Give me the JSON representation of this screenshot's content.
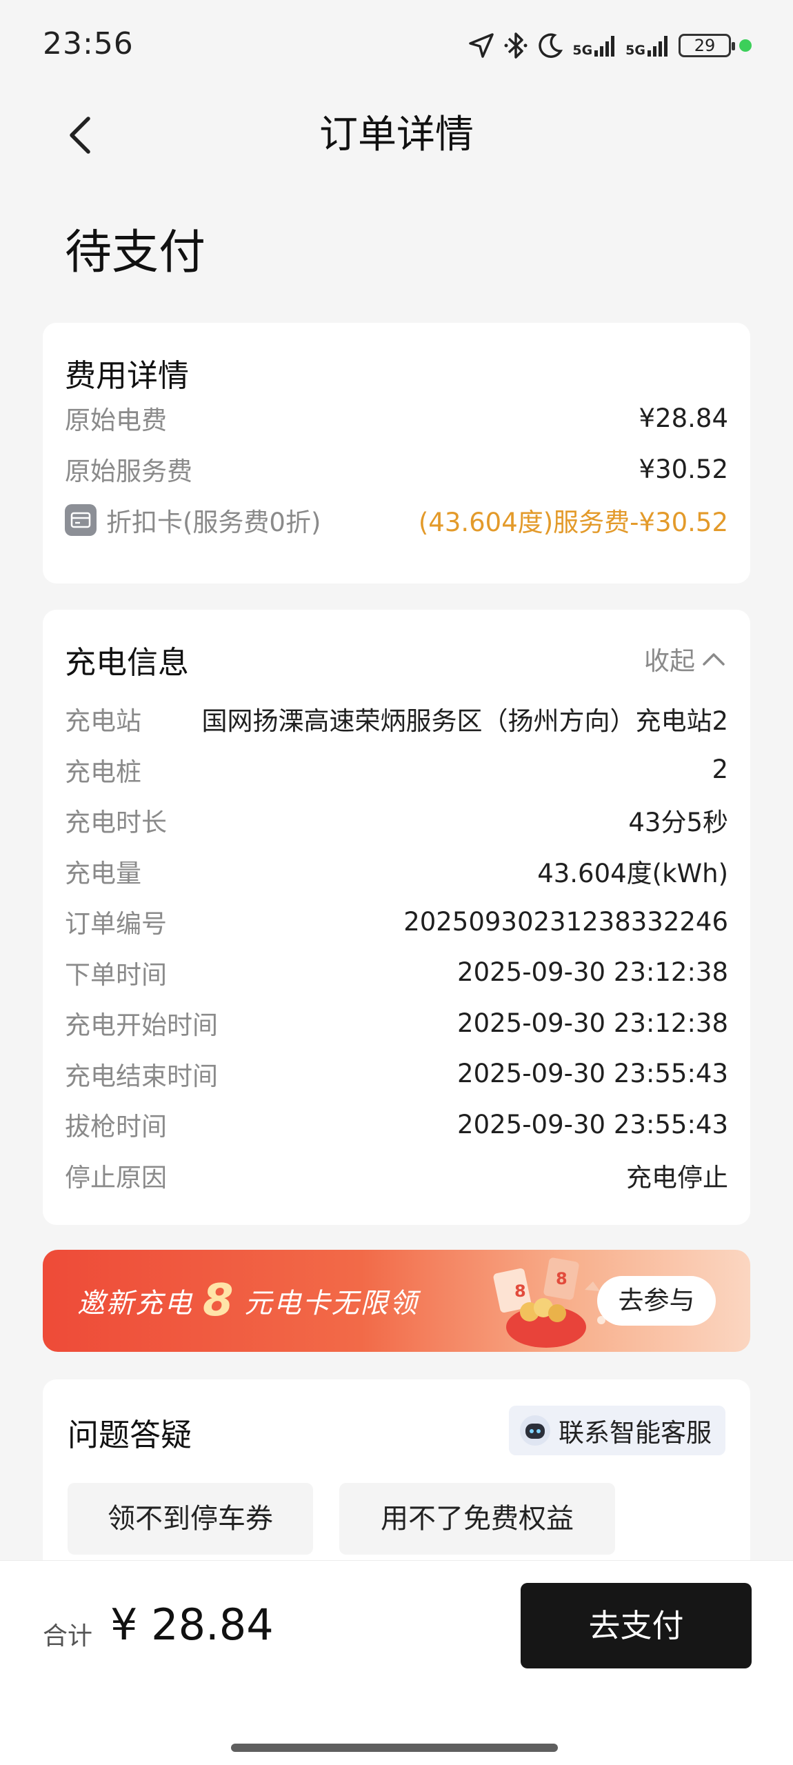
{
  "status_bar": {
    "time": "23:56",
    "battery": "29",
    "signal_1": "5G",
    "signal_2": "5G",
    "icons": [
      "location-icon",
      "bluetooth-icon",
      "moon-icon",
      "signal-icon",
      "battery-icon"
    ]
  },
  "nav": {
    "title": "订单详情"
  },
  "order_status": "待支付",
  "fee_details": {
    "title": "费用详情",
    "rows": [
      {
        "label": "原始电费",
        "value": "¥28.84"
      },
      {
        "label": "原始服务费",
        "value": "¥30.52"
      },
      {
        "label": "折扣卡(服务费0折)",
        "value": "(43.604度)服务费-¥30.52"
      }
    ],
    "discount_color": "#e39a2a"
  },
  "charge_info": {
    "title": "充电信息",
    "collapse_label": "收起",
    "rows": [
      {
        "label": "充电站",
        "value": "国网扬溧高速荣炳服务区（扬州方向）充电站2"
      },
      {
        "label": "充电桩",
        "value": "2"
      },
      {
        "label": "充电时长",
        "value": "43分5秒"
      },
      {
        "label": "充电量",
        "value": "43.604度(kWh)"
      },
      {
        "label": "订单编号",
        "value": "20250930231238332246"
      },
      {
        "label": "下单时间",
        "value": "2025-09-30 23:12:38"
      },
      {
        "label": "充电开始时间",
        "value": "2025-09-30 23:12:38"
      },
      {
        "label": "充电结束时间",
        "value": "2025-09-30 23:55:43"
      },
      {
        "label": "拔枪时间",
        "value": "2025-09-30 23:55:43"
      },
      {
        "label": "停止原因",
        "value": "充电停止"
      }
    ]
  },
  "banner": {
    "text_before": "邀新充电",
    "highlight": "8",
    "text_after": "元电卡无限领",
    "button": "去参与",
    "accent_color": "#ee4b38"
  },
  "qa": {
    "title": "问题答疑",
    "service_button": "联系智能客服",
    "chips": [
      "领不到停车券",
      "用不了免费权益"
    ]
  },
  "bottom": {
    "total_label": "合计",
    "total_amount": "¥ 28.84",
    "pay_button": "去支付"
  }
}
